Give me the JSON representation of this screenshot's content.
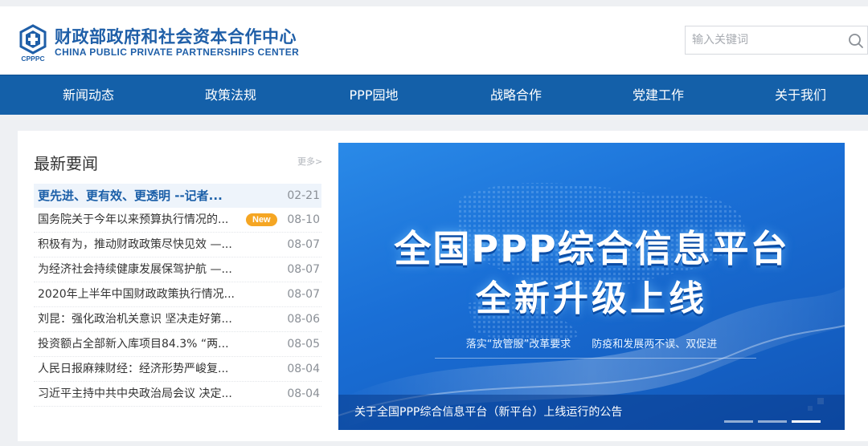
{
  "header": {
    "logo_cn": "财政部政府和社会资本合作中心",
    "logo_en": "CHINA PUBLIC PRIVATE PARTNERSHIPS CENTER",
    "logo_abbr": "CPPPC",
    "search_placeholder": "输入关键词"
  },
  "nav": {
    "items": [
      {
        "label": "新闻动态"
      },
      {
        "label": "政策法规"
      },
      {
        "label": "PPP园地"
      },
      {
        "label": "战略合作"
      },
      {
        "label": "党建工作"
      },
      {
        "label": "关于我们"
      }
    ]
  },
  "news": {
    "title": "最新要闻",
    "more": "更多>",
    "badge": "New",
    "items": [
      {
        "title": "更先进、更有效、更透明 --记者...",
        "date": "02-21"
      },
      {
        "title": "国务院关于今年以来预算执行情况的...",
        "date": "08-10"
      },
      {
        "title": "积极有为，推动财政政策尽快见效 —...",
        "date": "08-07"
      },
      {
        "title": "为经济社会持续健康发展保驾护航 —...",
        "date": "08-07"
      },
      {
        "title": "2020年上半年中国财政政策执行情况...",
        "date": "08-07"
      },
      {
        "title": "刘昆：强化政治机关意识 坚决走好第...",
        "date": "08-06"
      },
      {
        "title": "投资额占全部新入库项目84.3% “两...",
        "date": "08-05"
      },
      {
        "title": "人民日报麻辣财经：经济形势严峻复...",
        "date": "08-04"
      },
      {
        "title": "习近平主持中共中央政治局会议 决定...",
        "date": "08-04"
      }
    ]
  },
  "banner": {
    "headline1": "全国PPP综合信息平台",
    "headline2": "全新升级上线",
    "slogan": "落实“放管服”改革要求　　防疫和发展两不误、双促进",
    "caption": "关于全国PPP综合信息平台（新平台）上线运行的公告",
    "slide_count": 3,
    "active_slide": 3
  },
  "colors": {
    "brand": "#1f5fa8",
    "nav_bg": "#1460a9",
    "badge": "#f5a623"
  },
  "icons": {
    "logo": "cpppc-logo-icon",
    "search": "search-icon"
  }
}
